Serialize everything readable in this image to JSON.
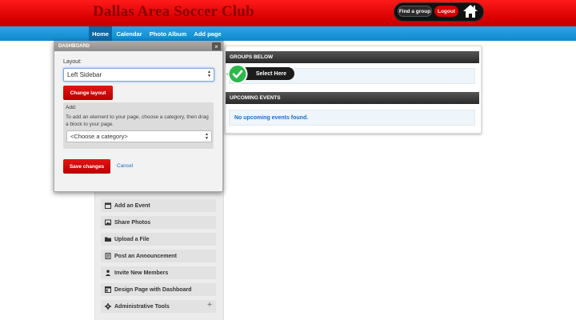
{
  "header": {
    "site_title": "Dallas Area Soccer Club",
    "find_group": "Find a group",
    "logout": "Logout",
    "home_icon": "home-icon"
  },
  "nav": {
    "items": [
      "Home",
      "Calendar",
      "Photo Album",
      "Add page"
    ],
    "active": "Home"
  },
  "dashboard": {
    "title": "DASHBOARD",
    "close": "×",
    "layout_label": "Layout:",
    "layout_value": "Left Sidebar",
    "change_layout": "Change layout",
    "add_label": "Add:",
    "add_instructions": "To add an element to your page, choose a category, then drag a block to your page.",
    "category_value": "<Choose a category>",
    "save": "Save changes",
    "cancel": "Cancel"
  },
  "callout": {
    "label": "Select Here"
  },
  "panels": {
    "groups_below": "GROUPS BELOW",
    "upcoming_events": "UPCOMING EVENTS",
    "no_events": "No upcoming events found."
  },
  "left_links": [
    {
      "label": "Add an Event",
      "icon": "calendar-icon"
    },
    {
      "label": "Share Photos",
      "icon": "photo-icon"
    },
    {
      "label": "Upload a File",
      "icon": "folder-icon"
    },
    {
      "label": "Post an Announcement",
      "icon": "announcement-icon"
    },
    {
      "label": "Invite New Members",
      "icon": "user-icon"
    },
    {
      "label": "Design Page with Dashboard",
      "icon": "dashboard-icon"
    },
    {
      "label": "Administrative Tools",
      "icon": "gear-icon",
      "expand": "+"
    }
  ],
  "colors": {
    "header_red": "#d80000",
    "nav_blue": "#1a9ae0",
    "button_red": "#cc0000",
    "link_blue": "#1a6ec0",
    "callout_green": "#2db84b"
  }
}
